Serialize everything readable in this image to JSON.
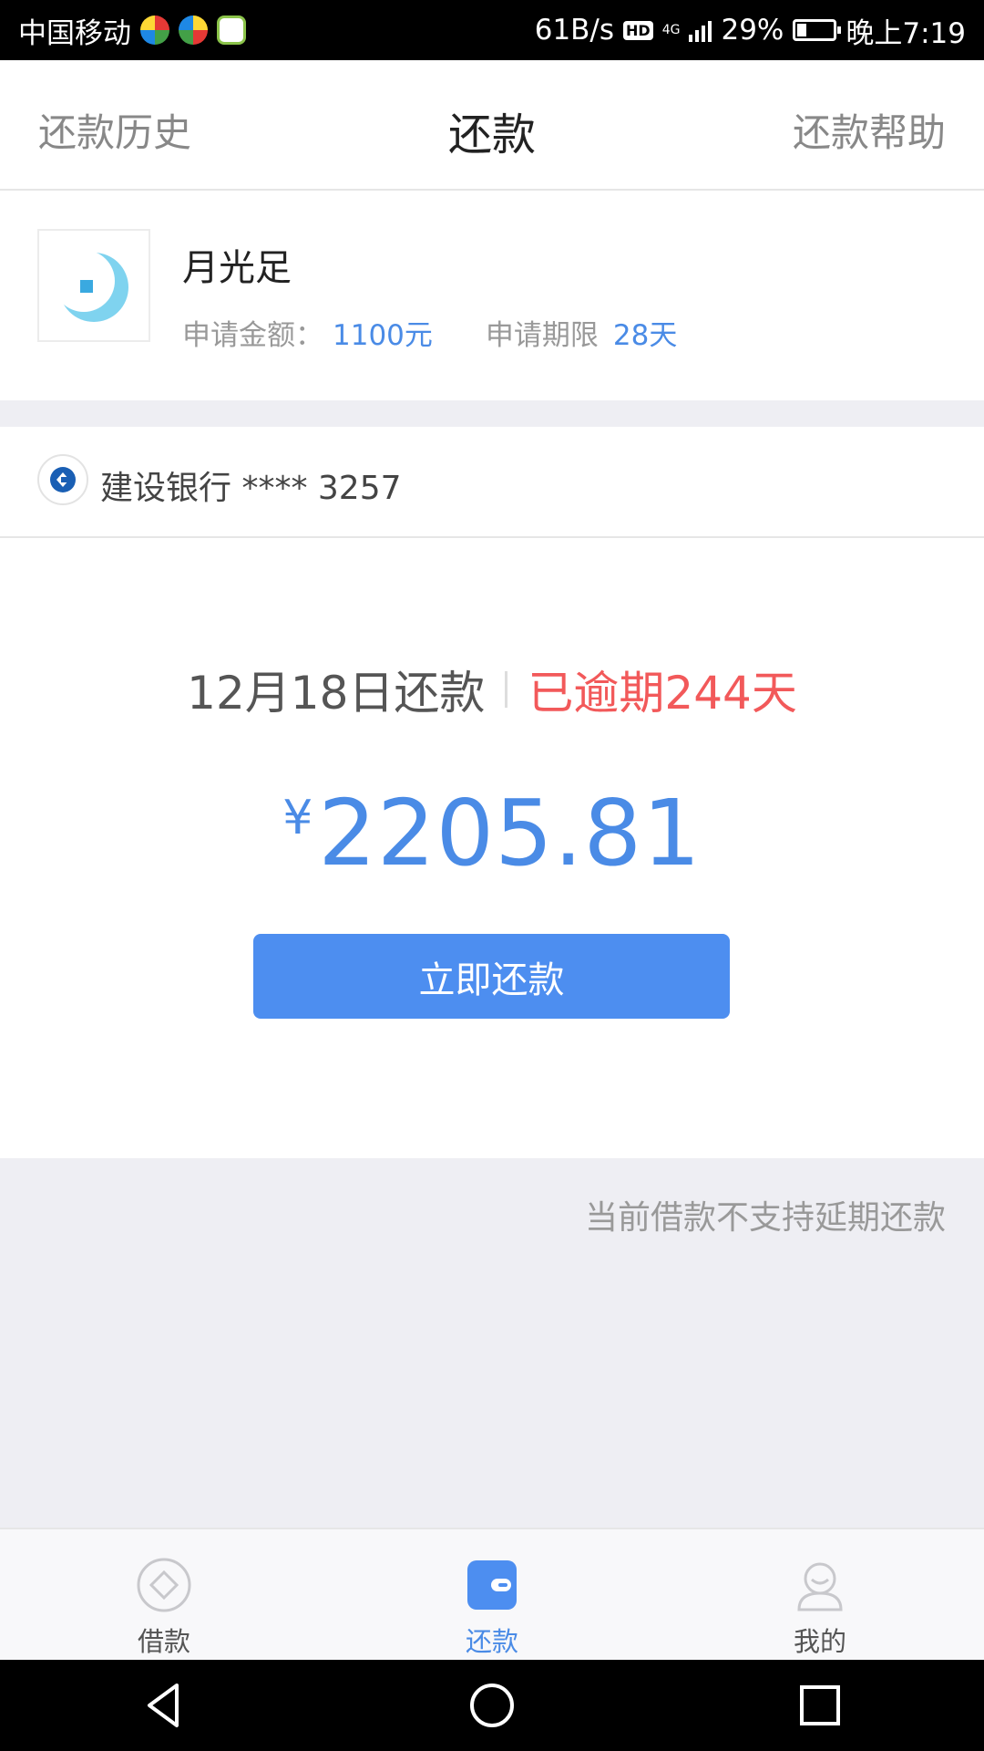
{
  "status_bar": {
    "carrier": "中国移动",
    "net_speed": "61B/s",
    "hd": "HD",
    "network": "4G",
    "battery": "29%",
    "time": "晚上7:19"
  },
  "header": {
    "left": "还款历史",
    "title": "还款",
    "right": "还款帮助"
  },
  "product": {
    "name": "月光足",
    "amount_label": "申请金额：",
    "amount_value": "1100元",
    "term_label": "申请期限",
    "term_value": "28天"
  },
  "bank": {
    "label": "建设银行 **** 3257"
  },
  "repay": {
    "due_date": "12月18日还款",
    "overdue": "已逾期244天",
    "currency": "¥",
    "amount": "2205.81",
    "button": "立即还款"
  },
  "notice": "当前借款不支持延期还款",
  "tabs": [
    {
      "label": "借款",
      "icon": "borrow-icon",
      "active": false
    },
    {
      "label": "还款",
      "icon": "repay-wallet-icon",
      "active": true
    },
    {
      "label": "我的",
      "icon": "user-icon",
      "active": false
    }
  ],
  "colors": {
    "accent": "#4a8be6",
    "button": "#4d8ef0",
    "overdue": "#f2595a",
    "gray_bg": "#eeeef3"
  }
}
